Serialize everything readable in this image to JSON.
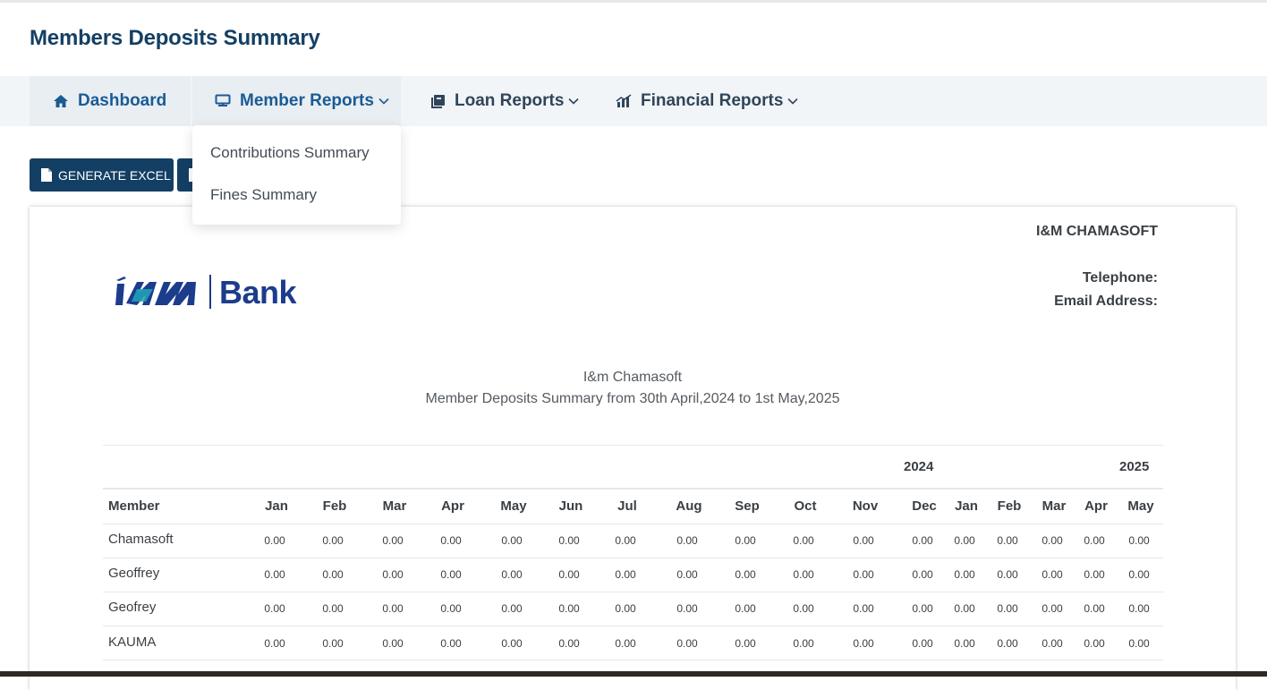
{
  "page": {
    "title": "Members Deposits Summary"
  },
  "nav": {
    "items": [
      {
        "label": "Dashboard",
        "icon": "home-icon"
      },
      {
        "label": "Member Reports",
        "icon": "monitor-icon"
      },
      {
        "label": "Loan Reports",
        "icon": "books-icon"
      },
      {
        "label": "Financial Reports",
        "icon": "chart-icon"
      }
    ],
    "dropdown": [
      "Contributions Summary",
      "Fines Summary"
    ]
  },
  "toolbar": {
    "excel_label": "GENERATE EXCEL"
  },
  "report": {
    "company": "I&M CHAMASOFT",
    "telephone_label": "Telephone:",
    "email_label": "Email Address:",
    "logo_text": "Bank",
    "org": "I&m Chamasoft",
    "subtitle": "Member Deposits Summary from 30th April,2024 to 1st May,2025"
  },
  "table": {
    "years": [
      "2024",
      "2025"
    ],
    "columns": [
      "Member",
      "Jan",
      "Feb",
      "Mar",
      "Apr",
      "May",
      "Jun",
      "Jul",
      "Aug",
      "Sep",
      "Oct",
      "Nov",
      "Dec",
      "Jan",
      "Feb",
      "Mar",
      "Apr",
      "May"
    ],
    "rows": [
      {
        "member": "Chamasoft",
        "values": [
          "0.00",
          "0.00",
          "0.00",
          "0.00",
          "0.00",
          "0.00",
          "0.00",
          "0.00",
          "0.00",
          "0.00",
          "0.00",
          "0.00",
          "0.00",
          "0.00",
          "0.00",
          "0.00",
          "0.00"
        ]
      },
      {
        "member": "Geoffrey",
        "values": [
          "0.00",
          "0.00",
          "0.00",
          "0.00",
          "0.00",
          "0.00",
          "0.00",
          "0.00",
          "0.00",
          "0.00",
          "0.00",
          "0.00",
          "0.00",
          "0.00",
          "0.00",
          "0.00",
          "0.00"
        ]
      },
      {
        "member": "Geofrey",
        "values": [
          "0.00",
          "0.00",
          "0.00",
          "0.00",
          "0.00",
          "0.00",
          "0.00",
          "0.00",
          "0.00",
          "0.00",
          "0.00",
          "0.00",
          "0.00",
          "0.00",
          "0.00",
          "0.00",
          "0.00"
        ]
      },
      {
        "member": "KAUMA",
        "values": [
          "0.00",
          "0.00",
          "0.00",
          "0.00",
          "0.00",
          "0.00",
          "0.00",
          "0.00",
          "0.00",
          "0.00",
          "0.00",
          "0.00",
          "0.00",
          "0.00",
          "0.00",
          "0.00",
          "0.00"
        ]
      }
    ]
  },
  "colors": {
    "primary": "#143f64",
    "nav_active": "#1a5b94",
    "logo": "#1c3c8c"
  }
}
